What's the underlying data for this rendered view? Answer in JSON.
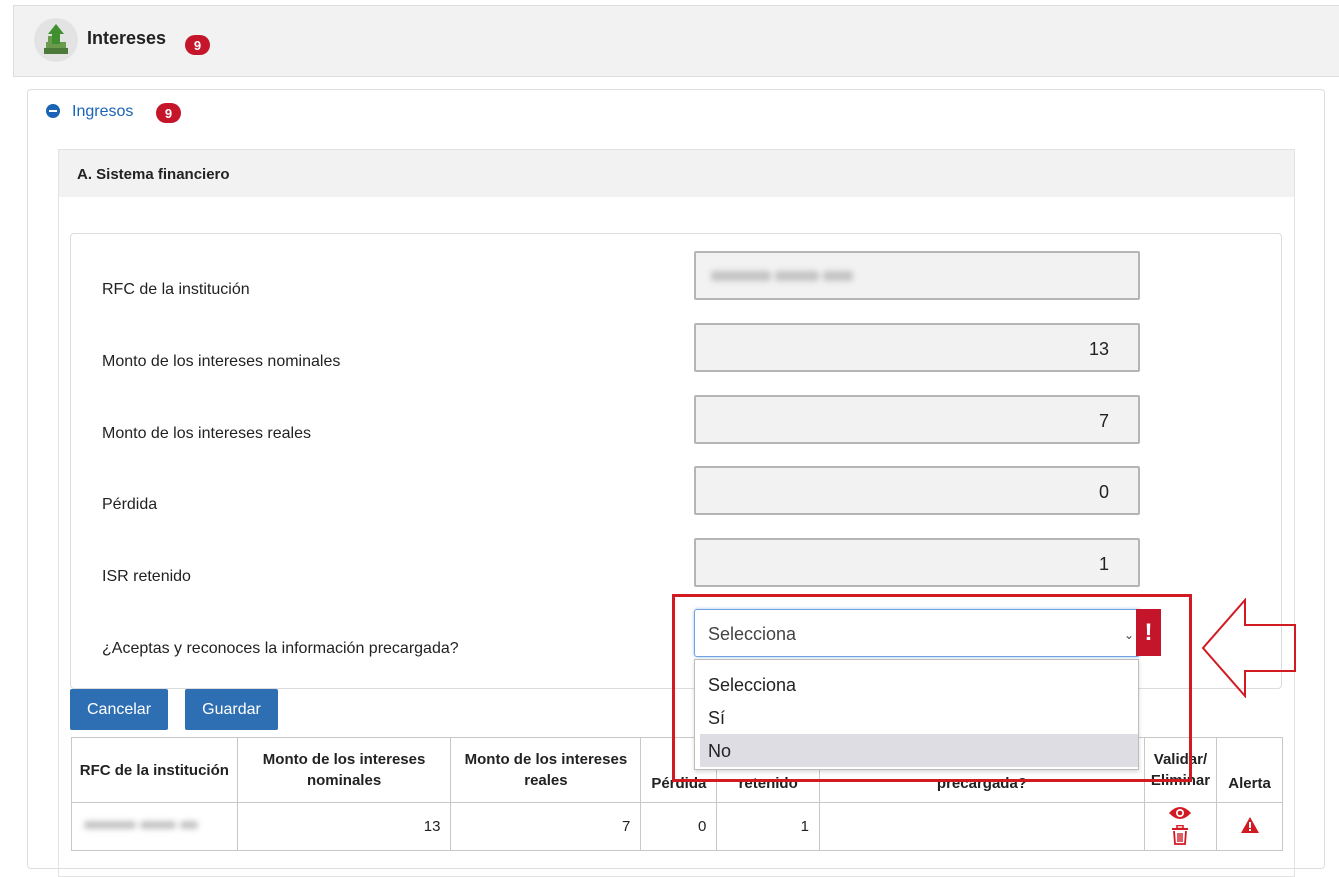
{
  "header": {
    "title": "Intereses",
    "badge": "9"
  },
  "ingresos": {
    "label": "Ingresos",
    "badge": "9"
  },
  "section": {
    "title": "A. Sistema financiero"
  },
  "form": {
    "fields": [
      {
        "label": "RFC de la institución",
        "value": ""
      },
      {
        "label": "Monto de los intereses nominales",
        "value": "13"
      },
      {
        "label": "Monto de los intereses reales",
        "value": "7"
      },
      {
        "label": "Pérdida",
        "value": "0"
      },
      {
        "label": "ISR retenido",
        "value": "1"
      }
    ],
    "question": "¿Aceptas y reconoces la información precargada?",
    "select_value": "Selecciona",
    "alert_mark": "!",
    "options": [
      "Selecciona",
      "Sí",
      "No"
    ]
  },
  "buttons": {
    "cancel": "Cancelar",
    "save": "Guardar"
  },
  "table": {
    "headers": [
      "RFC de la institución",
      "Monto de los intereses nominales",
      "Monto de los intereses reales",
      "Pérdida",
      "retenido",
      "precargada?",
      "Validar/ Eliminar",
      "Alerta"
    ],
    "rows": [
      {
        "nominales": "13",
        "reales": "7",
        "perdida": "0",
        "isr": "1"
      }
    ]
  },
  "colors": {
    "accent": "#2e6fb4",
    "badge": "#c5152b",
    "highlight": "#d21a23"
  },
  "icons": [
    "intereses-app-icon",
    "collapse-minus-icon",
    "chevron-down-icon",
    "eye-icon",
    "trash-icon",
    "warning-icon",
    "arrow-left-outline-icon"
  ]
}
